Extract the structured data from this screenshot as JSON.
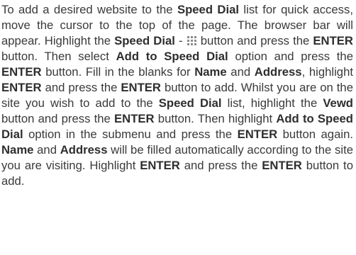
{
  "manual": {
    "seg01": "To add a desired website to the ",
    "seg02": "Speed Dial",
    "seg03": " list for quick access, move the cursor to the top of the page. The browser bar will appear. Highlight the ",
    "seg04": "Speed Dial",
    "seg05": " - ",
    "seg06": " button and press the ",
    "seg07": "ENTER",
    "seg08": " button. Then select ",
    "seg09": "Add to Speed Dial",
    "seg10": " option and press the ",
    "seg11": "ENTER",
    "seg12": " button. Fill in the blanks for ",
    "seg13": "Name",
    "seg14": " and ",
    "seg15": "Address",
    "seg16": ", highlight ",
    "seg17": "ENTER",
    "seg18": " and press the ",
    "seg19": "ENTER",
    "seg20": " button to add. Whilst you are on the site you wish to add to the ",
    "seg21": "Speed Dial",
    "seg22": " list, highlight the ",
    "seg23": "Vewd",
    "seg24": " button and press the ",
    "seg25": "ENTER",
    "seg26": " button. Then highlight ",
    "seg27": "Add to Speed Dial",
    "seg28": " option in the submenu and press the ",
    "seg29": "ENTER",
    "seg30": " button again. ",
    "seg31": "Name",
    "seg32": " and ",
    "seg33": "Address",
    "seg34": " will be filled automatically according to the site you are visiting. Highlight ",
    "seg35": "ENTER",
    "seg36": " and press the ",
    "seg37": "ENTER",
    "seg38": " button to add."
  },
  "icons": {
    "speed_dial_icon": "speed-dial-grid-icon",
    "icon_color": "#8a8a8a"
  },
  "colors": {
    "text": "#3a3a3a",
    "background": "#ffffff"
  }
}
